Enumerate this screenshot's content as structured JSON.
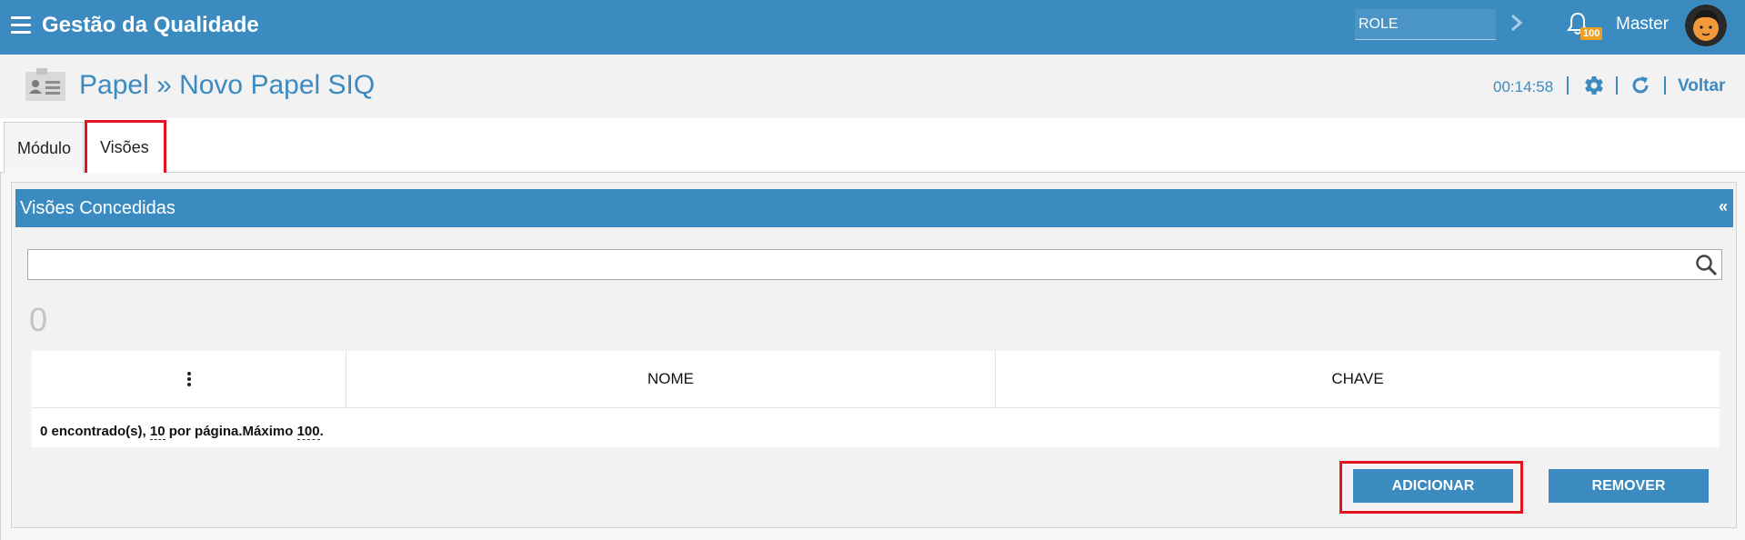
{
  "app": {
    "title": "Gestão da Qualidade"
  },
  "topbar": {
    "role_placeholder": "ROLE",
    "notifications_count": "100",
    "user_name": "Master"
  },
  "header": {
    "title": "Papel » Novo Papel SIQ",
    "timer": "00:14:58",
    "back_label": "Voltar"
  },
  "tabs": [
    {
      "label": "Módulo"
    },
    {
      "label": "Visões",
      "active": true
    }
  ],
  "panel": {
    "title": "Visões Concedidas",
    "collapse_label": "«",
    "search_value": "",
    "count": "0",
    "table": {
      "columns": [
        "",
        "NOME",
        "CHAVE"
      ],
      "rows": []
    },
    "footer": {
      "found_prefix": "0 encontrado(s), ",
      "per_page": "10",
      "per_page_suffix": " por página.Máximo ",
      "max": "100",
      "max_suffix": "."
    },
    "buttons": {
      "add": "ADICIONAR",
      "remove": "REMOVER"
    }
  },
  "colors": {
    "primary": "#3b8ac0",
    "highlight": "#e2141f",
    "badge": "#f0a020"
  }
}
